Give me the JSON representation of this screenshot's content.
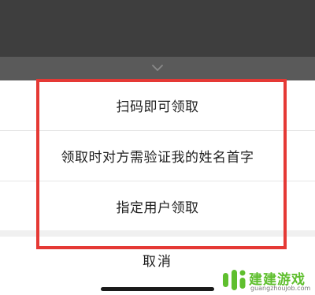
{
  "action_sheet": {
    "options": [
      "扫码即可领取",
      "领取时对方需验证我的姓名首字",
      "指定用户领取"
    ],
    "cancel_label": "取消"
  },
  "watermark": {
    "title": "建建游戏",
    "domain": "guangzhoujob.com"
  },
  "colors": {
    "highlight_border": "#e53935",
    "watermark_green": "#5fbf2e"
  },
  "icons": [
    "chevron-down-icon",
    "watermark-logo-icon"
  ]
}
